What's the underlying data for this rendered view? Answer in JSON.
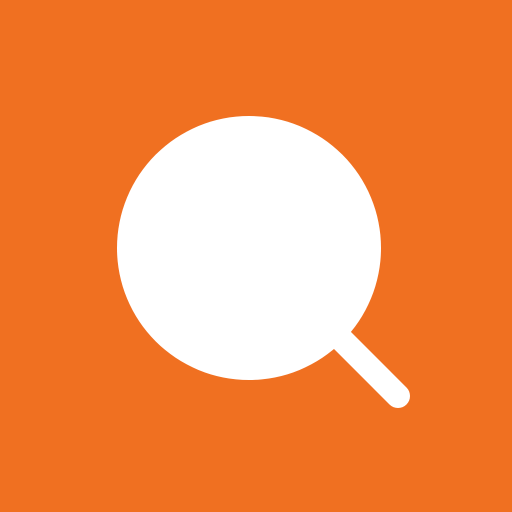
{
  "icon": {
    "name": "search-icon",
    "background_color": "#F07021",
    "foreground_color": "#FFFFFF"
  }
}
